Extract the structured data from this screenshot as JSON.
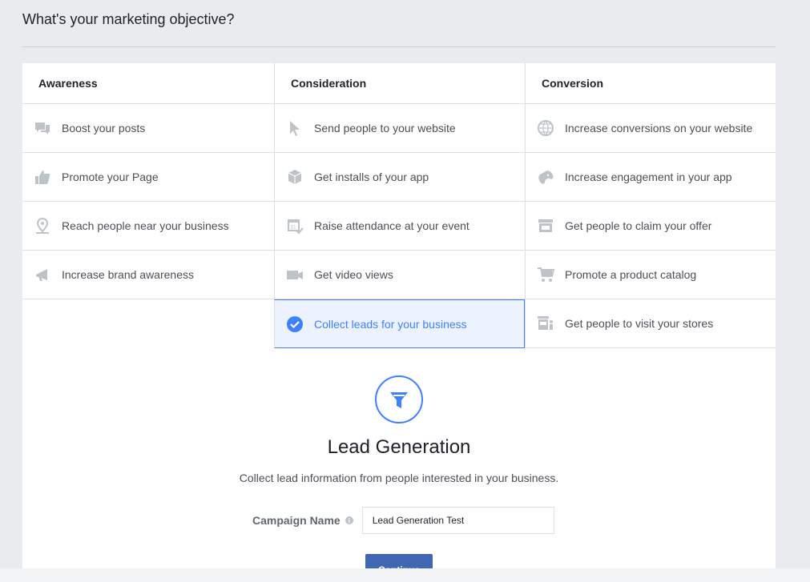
{
  "page": {
    "title": "What's your marketing objective?"
  },
  "columns": [
    {
      "header": "Awareness",
      "items": [
        {
          "label": "Boost your posts",
          "icon": "speech-bubbles-icon"
        },
        {
          "label": "Promote your Page",
          "icon": "thumbs-up-icon"
        },
        {
          "label": "Reach people near your business",
          "icon": "location-pin-icon"
        },
        {
          "label": "Increase brand awareness",
          "icon": "megaphone-icon"
        }
      ]
    },
    {
      "header": "Consideration",
      "items": [
        {
          "label": "Send people to your website",
          "icon": "cursor-icon"
        },
        {
          "label": "Get installs of your app",
          "icon": "box-icon"
        },
        {
          "label": "Raise attendance at your event",
          "icon": "calendar-icon"
        },
        {
          "label": "Get video views",
          "icon": "video-camera-icon"
        },
        {
          "label": "Collect leads for your business",
          "icon": "checkmark-icon",
          "selected": true
        }
      ]
    },
    {
      "header": "Conversion",
      "items": [
        {
          "label": "Increase conversions on your website",
          "icon": "globe-icon"
        },
        {
          "label": "Increase engagement in your app",
          "icon": "gamepad-icon"
        },
        {
          "label": "Get people to claim your offer",
          "icon": "storefront-icon"
        },
        {
          "label": "Promote a product catalog",
          "icon": "shopping-cart-icon"
        },
        {
          "label": "Get people to visit your stores",
          "icon": "store-visit-icon"
        }
      ]
    }
  ],
  "lead": {
    "icon": "funnel-icon",
    "title": "Lead Generation",
    "description": "Collect lead information from people interested in your business."
  },
  "form": {
    "campaign_label": "Campaign Name",
    "info_glyph": "i",
    "campaign_value": "Lead Generation Test",
    "continue_label": "Continue"
  },
  "colors": {
    "accent": "#4080ff",
    "button": "#4267b2",
    "icon": "#bec3c9"
  }
}
